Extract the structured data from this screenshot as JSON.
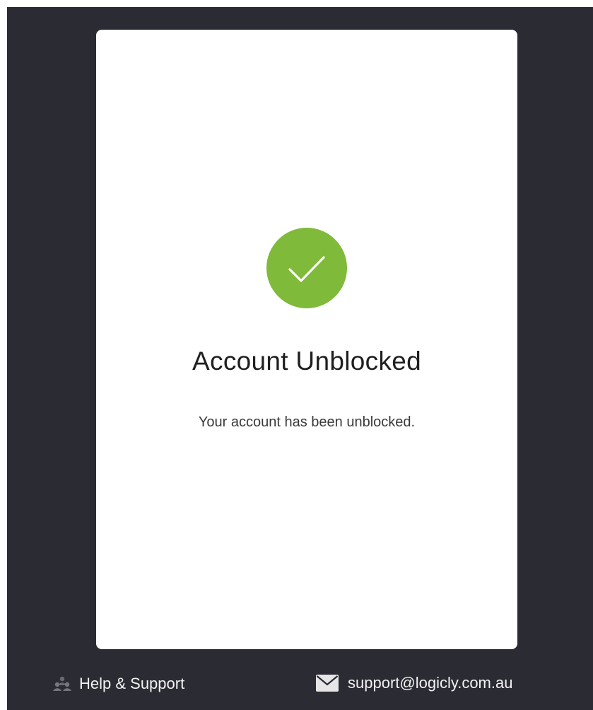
{
  "card": {
    "status_icon": "check-icon",
    "title": "Account Unblocked",
    "message": "Your account has been unblocked."
  },
  "footer": {
    "help": {
      "icon": "people-icon",
      "label": "Help & Support"
    },
    "contact": {
      "icon": "mail-icon",
      "label": "support@logicly.com.au"
    }
  },
  "colors": {
    "background": "#2b2b33",
    "card": "#ffffff",
    "success": "#7fba3a",
    "footer_text": "#f2f2f2"
  }
}
